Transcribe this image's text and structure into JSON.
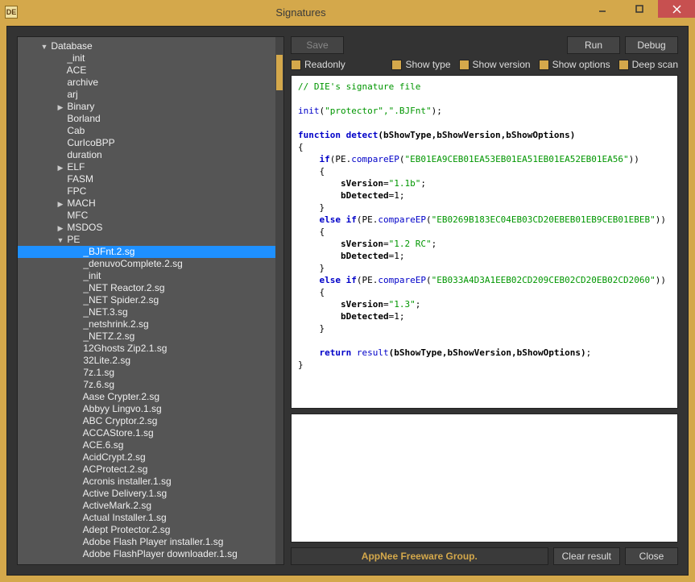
{
  "window": {
    "title": "Signatures",
    "icon_text": "DE"
  },
  "buttons": {
    "save": "Save",
    "run": "Run",
    "debug": "Debug",
    "clear_result": "Clear result",
    "close": "Close"
  },
  "options": {
    "readonly": "Readonly",
    "show_type": "Show type",
    "show_version": "Show version",
    "show_options": "Show options",
    "deep_scan": "Deep scan"
  },
  "footer": {
    "credit": "AppNee Freeware Group."
  },
  "tree": {
    "root": {
      "label": "Database",
      "expanded": true
    },
    "items": [
      {
        "label": "_init",
        "depth": 2,
        "arrow": ""
      },
      {
        "label": "ACE",
        "depth": 2,
        "arrow": ""
      },
      {
        "label": "archive",
        "depth": 2,
        "arrow": ""
      },
      {
        "label": "arj",
        "depth": 2,
        "arrow": ""
      },
      {
        "label": "Binary",
        "depth": 2,
        "arrow": "▶"
      },
      {
        "label": "Borland",
        "depth": 2,
        "arrow": ""
      },
      {
        "label": "Cab",
        "depth": 2,
        "arrow": ""
      },
      {
        "label": "CurIcoBPP",
        "depth": 2,
        "arrow": ""
      },
      {
        "label": "duration",
        "depth": 2,
        "arrow": ""
      },
      {
        "label": "ELF",
        "depth": 2,
        "arrow": "▶"
      },
      {
        "label": "FASM",
        "depth": 2,
        "arrow": ""
      },
      {
        "label": "FPC",
        "depth": 2,
        "arrow": ""
      },
      {
        "label": "MACH",
        "depth": 2,
        "arrow": "▶"
      },
      {
        "label": "MFC",
        "depth": 2,
        "arrow": ""
      },
      {
        "label": "MSDOS",
        "depth": 2,
        "arrow": "▶"
      },
      {
        "label": "PE",
        "depth": 2,
        "arrow": "▼"
      },
      {
        "label": "_BJFnt.2.sg",
        "depth": 3,
        "arrow": "",
        "selected": true
      },
      {
        "label": "_denuvoComplete.2.sg",
        "depth": 3,
        "arrow": ""
      },
      {
        "label": "_init",
        "depth": 3,
        "arrow": ""
      },
      {
        "label": "_NET Reactor.2.sg",
        "depth": 3,
        "arrow": ""
      },
      {
        "label": "_NET Spider.2.sg",
        "depth": 3,
        "arrow": ""
      },
      {
        "label": "_NET.3.sg",
        "depth": 3,
        "arrow": ""
      },
      {
        "label": "_netshrink.2.sg",
        "depth": 3,
        "arrow": ""
      },
      {
        "label": "_NETZ.2.sg",
        "depth": 3,
        "arrow": ""
      },
      {
        "label": "12Ghosts Zip2.1.sg",
        "depth": 3,
        "arrow": ""
      },
      {
        "label": "32Lite.2.sg",
        "depth": 3,
        "arrow": ""
      },
      {
        "label": "7z.1.sg",
        "depth": 3,
        "arrow": ""
      },
      {
        "label": "7z.6.sg",
        "depth": 3,
        "arrow": ""
      },
      {
        "label": "Aase Crypter.2.sg",
        "depth": 3,
        "arrow": ""
      },
      {
        "label": "Abbyy Lingvo.1.sg",
        "depth": 3,
        "arrow": ""
      },
      {
        "label": "ABC Cryptor.2.sg",
        "depth": 3,
        "arrow": ""
      },
      {
        "label": "ACCAStore.1.sg",
        "depth": 3,
        "arrow": ""
      },
      {
        "label": "ACE.6.sg",
        "depth": 3,
        "arrow": ""
      },
      {
        "label": "AcidCrypt.2.sg",
        "depth": 3,
        "arrow": ""
      },
      {
        "label": "ACProtect.2.sg",
        "depth": 3,
        "arrow": ""
      },
      {
        "label": "Acronis installer.1.sg",
        "depth": 3,
        "arrow": ""
      },
      {
        "label": "Active Delivery.1.sg",
        "depth": 3,
        "arrow": ""
      },
      {
        "label": "ActiveMark.2.sg",
        "depth": 3,
        "arrow": ""
      },
      {
        "label": "Actual Installer.1.sg",
        "depth": 3,
        "arrow": ""
      },
      {
        "label": "Adept Protector.2.sg",
        "depth": 3,
        "arrow": ""
      },
      {
        "label": "Adobe Flash Player installer.1.sg",
        "depth": 3,
        "arrow": ""
      },
      {
        "label": "Adobe FlashPlayer downloader.1.sg",
        "depth": 3,
        "arrow": ""
      }
    ]
  },
  "code": {
    "comment": "// DIE's signature file",
    "init_args": "\"protector\",\".BJFnt\"",
    "detect_sig": "bShowType,bShowVersion,bShowOptions",
    "ep1": "\"EB01EA9CEB01EA53EB01EA51EB01EA52EB01EA56\"",
    "v1": "\"1.1b\"",
    "ep2": "\"EB0269B183EC04EB03CD20EBEB01EB9CEB01EBEB\"",
    "v2": "\"1.2 RC\"",
    "ep3": "\"EB033A4D3A1EEB02CD209CEB02CD20EB02CD2060\"",
    "v3": "\"1.3\"",
    "ret_args": "bShowType,bShowVersion,bShowOptions"
  }
}
